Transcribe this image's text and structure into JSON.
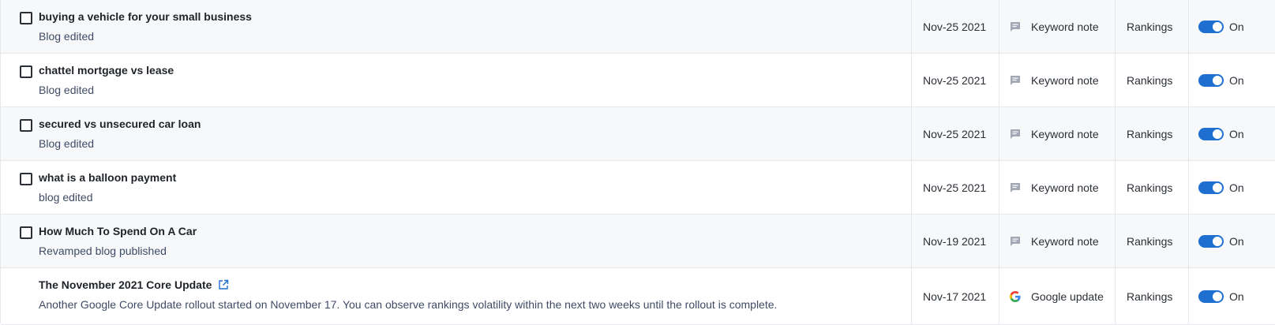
{
  "rows": [
    {
      "title": "buying a vehicle for your small business",
      "subtitle": "Blog edited",
      "date": "Nov-25 2021",
      "note_type": "Keyword note",
      "note_icon": "comment-icon",
      "category": "Rankings",
      "toggle_label": "On",
      "toggle_on": true
    },
    {
      "title": "chattel mortgage vs lease",
      "subtitle": "Blog edited",
      "date": "Nov-25 2021",
      "note_type": "Keyword note",
      "note_icon": "comment-icon",
      "category": "Rankings",
      "toggle_label": "On",
      "toggle_on": true
    },
    {
      "title": "secured vs unsecured car loan",
      "subtitle": "Blog edited",
      "date": "Nov-25 2021",
      "note_type": "Keyword note",
      "note_icon": "comment-icon",
      "category": "Rankings",
      "toggle_label": "On",
      "toggle_on": true
    },
    {
      "title": "what is a balloon payment",
      "subtitle": "blog edited",
      "date": "Nov-25 2021",
      "note_type": "Keyword note",
      "note_icon": "comment-icon",
      "category": "Rankings",
      "toggle_label": "On",
      "toggle_on": true
    },
    {
      "title": "How Much To Spend On A Car",
      "subtitle": "Revamped blog published",
      "date": "Nov-19 2021",
      "note_type": "Keyword note",
      "note_icon": "comment-icon",
      "category": "Rankings",
      "toggle_label": "On",
      "toggle_on": true
    },
    {
      "title": "The November 2021 Core Update",
      "subtitle": "Another Google Core Update rollout started on November 17. You can observe rankings volatility within the next two weeks until the rollout is complete.",
      "date": "Nov-17 2021",
      "note_type": "Google update",
      "note_icon": "google-icon",
      "category": "Rankings",
      "toggle_label": "On",
      "toggle_on": true,
      "external_link_icon": "external-link-icon"
    }
  ],
  "colors": {
    "accent": "#1f6fd1",
    "row_alt_bg": "#f7f8fa",
    "border": "#e6e8ec",
    "icon_grey": "#a3a9b4"
  }
}
